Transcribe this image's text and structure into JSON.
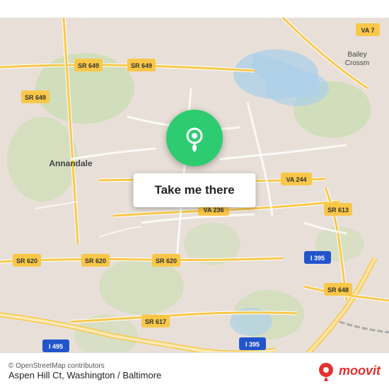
{
  "map": {
    "attribution": "© OpenStreetMap contributors",
    "location_label": "Aspen Hill Ct, Washington / Baltimore",
    "cta_button": "Take me there",
    "road_labels": [
      "SR 649",
      "SR 649",
      "VA 7",
      "VA 244",
      "VA 236",
      "SR 613",
      "SR 620",
      "SR 620",
      "SR 620",
      "I 395",
      "I 395",
      "SR 648",
      "I 495",
      "SR 617",
      "SR 649"
    ],
    "city_labels": [
      "Annandale",
      "Bailey\nCrossm"
    ],
    "bg_color": "#e8e0d8",
    "road_color": "#ffffff",
    "highway_color": "#f9c748"
  },
  "moovit": {
    "brand": "moovit",
    "icon_color": "#e63030"
  }
}
